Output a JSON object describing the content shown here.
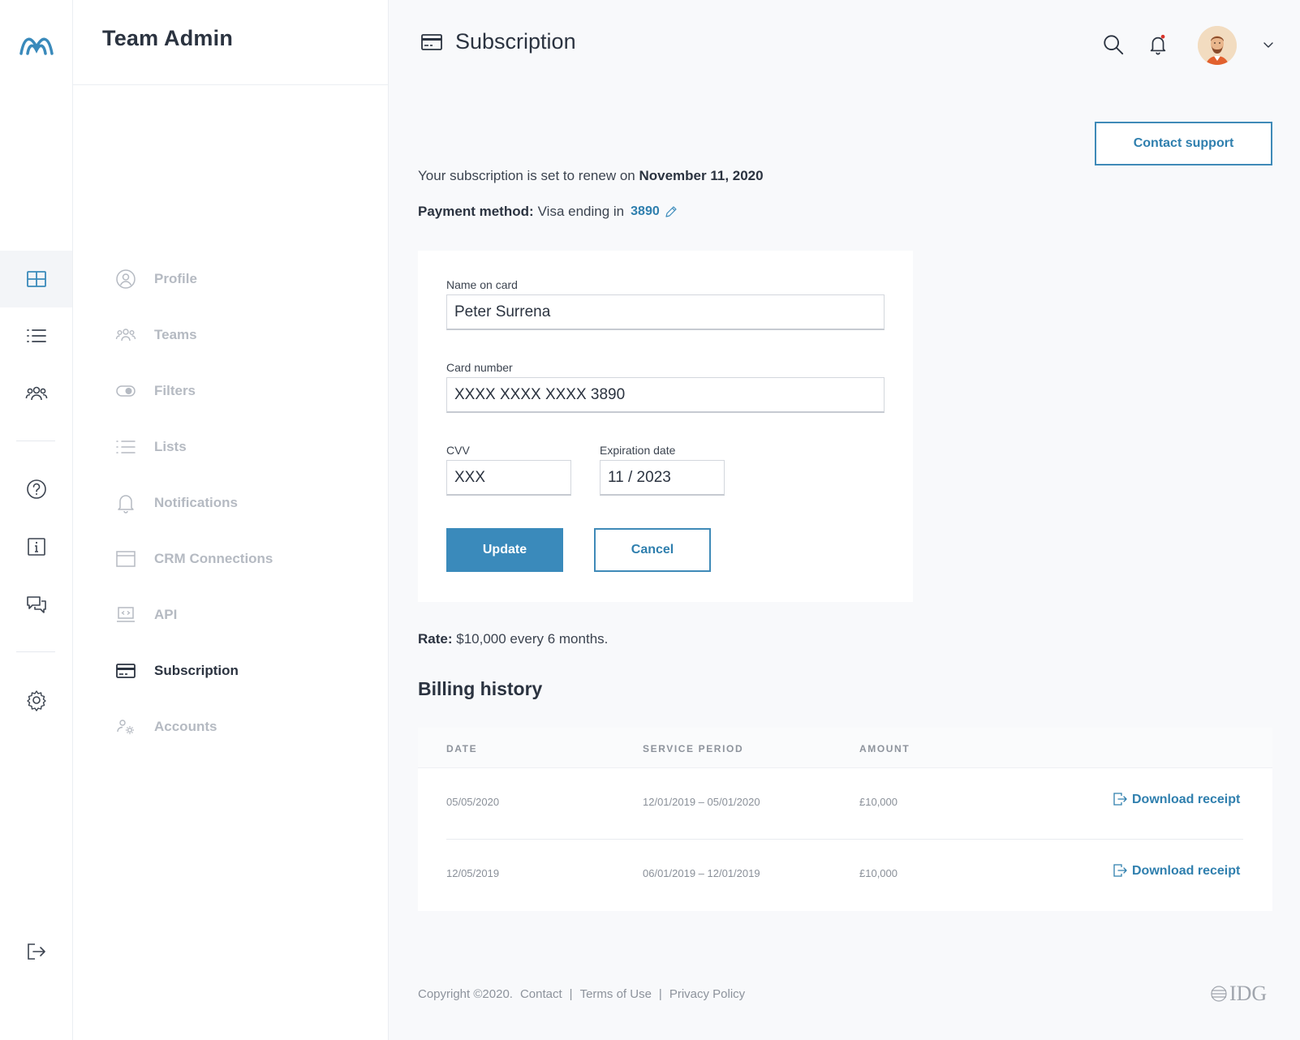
{
  "sidebar_rail": {
    "icons": [
      "logo-icon",
      "dashboard-grid-icon",
      "list-icon",
      "people-icon",
      "help-icon",
      "info-icon",
      "chat-icon",
      "settings-icon",
      "logout-icon"
    ]
  },
  "subnav": {
    "title": "Team Admin",
    "items": [
      {
        "label": "Profile"
      },
      {
        "label": "Teams"
      },
      {
        "label": "Filters"
      },
      {
        "label": "Lists"
      },
      {
        "label": "Notifications"
      },
      {
        "label": "CRM Connections"
      },
      {
        "label": "API"
      },
      {
        "label": "Subscription",
        "active": true
      },
      {
        "label": "Accounts"
      }
    ]
  },
  "header": {
    "title": "Subscription",
    "notification_dot_color": "#d9342b"
  },
  "support_button": "Contact support",
  "renewal": {
    "prefix": "Your subscription is set to renew on",
    "date": "November 11, 2020"
  },
  "payment": {
    "label": "Payment method:",
    "text": "Visa ending in",
    "last4": "3890"
  },
  "card_form": {
    "name_label": "Name on card",
    "name_value": "Peter Surrena",
    "number_label": "Card number",
    "number_value": "XXXX XXXX XXXX 3890",
    "cvv_label": "CVV",
    "cvv_value": "XXX",
    "exp_label": "Expiration date",
    "exp_value": "11 / 2023",
    "update_label": "Update",
    "cancel_label": "Cancel"
  },
  "rate": {
    "label": "Rate:",
    "value": "$10,000 every 6 months."
  },
  "billing": {
    "title": "Billing history",
    "columns": [
      "DATE",
      "SERVICE PERIOD",
      "AMOUNT"
    ],
    "rows": [
      {
        "date": "05/05/2020",
        "period": "12/01/2019 – 05/01/2020",
        "amount": "£10,000",
        "action": "Download receipt"
      },
      {
        "date": "12/05/2019",
        "period": "06/01/2019 – 12/01/2019",
        "amount": "£10,000",
        "action": "Download receipt"
      }
    ]
  },
  "footer": {
    "copyright": "Copyright ©2020.",
    "links": [
      "Contact",
      "Terms of Use",
      "Privacy Policy"
    ],
    "separator": "|",
    "brand": "IDG"
  },
  "colors": {
    "accent": "#3a8abb",
    "text": "#2b3340",
    "muted": "#b5bac2"
  }
}
